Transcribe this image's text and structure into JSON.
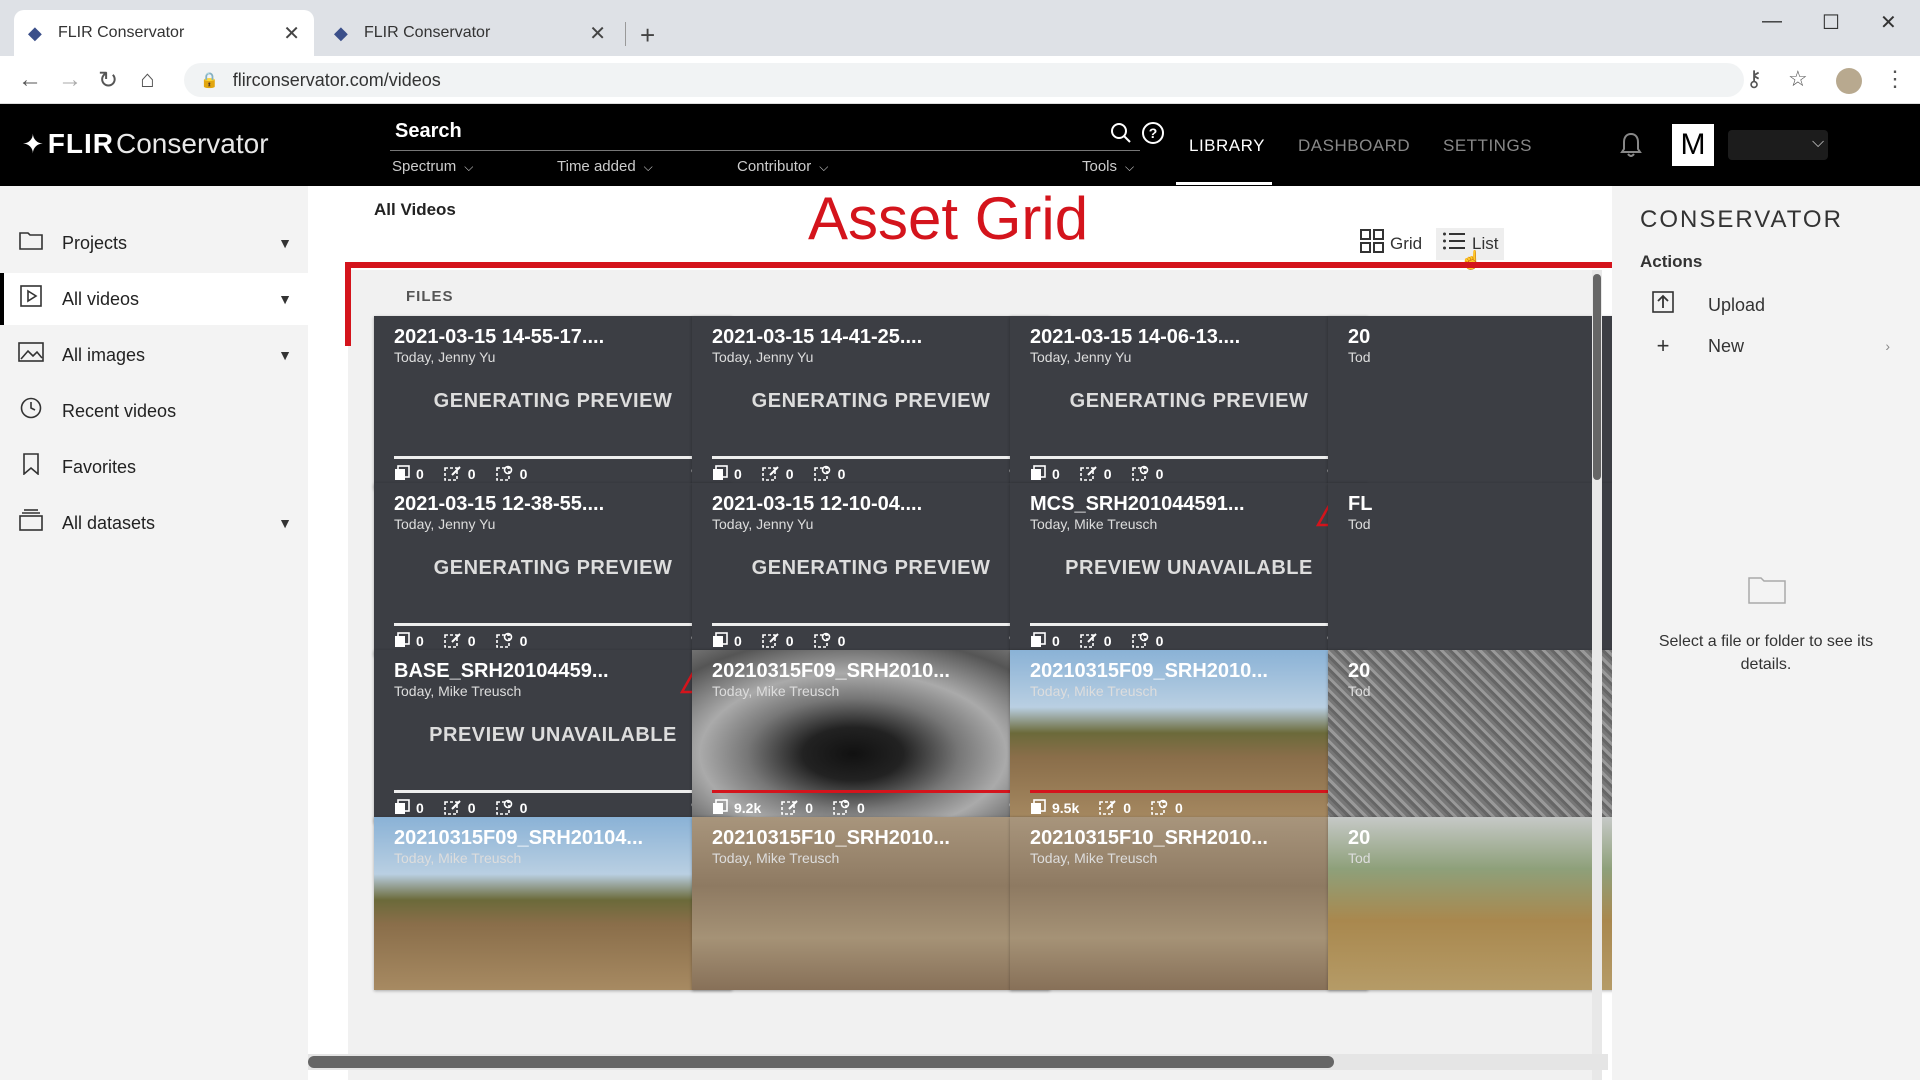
{
  "browser": {
    "tabs": [
      {
        "title": "FLIR Conservator",
        "close": "✕",
        "active": true
      },
      {
        "title": "FLIR Conservator",
        "close": "✕",
        "active": false
      }
    ],
    "new_tab": "+",
    "url": "flirconservator.com/videos"
  },
  "app": {
    "logo_brand": "FLIR",
    "logo_product": "Conservator",
    "search_label": "Search",
    "filters": [
      "Spectrum",
      "Time added",
      "Contributor",
      "Tools"
    ],
    "nav": [
      {
        "label": "LIBRARY",
        "active": true
      },
      {
        "label": "DASHBOARD",
        "active": false
      },
      {
        "label": "SETTINGS",
        "active": false
      }
    ],
    "user_initial": "M"
  },
  "sidebar": {
    "items": [
      {
        "label": "Projects",
        "icon": "folder-icon",
        "has_arrow": true,
        "active": false
      },
      {
        "label": "All videos",
        "icon": "video-icon",
        "has_arrow": true,
        "active": true
      },
      {
        "label": "All images",
        "icon": "image-icon",
        "has_arrow": true,
        "active": false
      },
      {
        "label": "Recent videos",
        "icon": "clock-icon",
        "has_arrow": false,
        "active": false
      },
      {
        "label": "Favorites",
        "icon": "bookmark-icon",
        "has_arrow": false,
        "active": false
      },
      {
        "label": "All datasets",
        "icon": "dataset-icon",
        "has_arrow": true,
        "active": false
      }
    ]
  },
  "main": {
    "heading": "All Videos",
    "annotation": "Asset Grid",
    "view_grid": "Grid",
    "view_list": "List",
    "section": "FILES",
    "cards": [
      {
        "title": "2021-03-15 14-55-17....",
        "sub": "Today, Jenny Yu",
        "status": "GENERATING PREVIEW",
        "frames": "0",
        "annotations": "0",
        "labels": "0",
        "warn": false,
        "thumb": "",
        "bar": "white"
      },
      {
        "title": "2021-03-15 14-41-25....",
        "sub": "Today, Jenny Yu",
        "status": "GENERATING PREVIEW",
        "frames": "0",
        "annotations": "0",
        "labels": "0",
        "warn": false,
        "thumb": "",
        "bar": "white"
      },
      {
        "title": "2021-03-15 14-06-13....",
        "sub": "Today, Jenny Yu",
        "status": "GENERATING PREVIEW",
        "frames": "0",
        "annotations": "0",
        "labels": "0",
        "warn": false,
        "thumb": "",
        "bar": "white"
      },
      {
        "title": "20",
        "sub": "Tod",
        "status": "",
        "frames": "",
        "annotations": "",
        "labels": "",
        "warn": false,
        "thumb": "",
        "bar": "none"
      },
      {
        "title": "2021-03-15 12-38-55....",
        "sub": "Today, Jenny Yu",
        "status": "GENERATING PREVIEW",
        "frames": "0",
        "annotations": "0",
        "labels": "0",
        "warn": false,
        "thumb": "",
        "bar": "white"
      },
      {
        "title": "2021-03-15 12-10-04....",
        "sub": "Today, Jenny Yu",
        "status": "GENERATING PREVIEW",
        "frames": "0",
        "annotations": "0",
        "labels": "0",
        "warn": false,
        "thumb": "",
        "bar": "white"
      },
      {
        "title": "MCS_SRH201044591...",
        "sub": "Today, Mike Treusch",
        "status": "PREVIEW UNAVAILABLE",
        "frames": "0",
        "annotations": "0",
        "labels": "0",
        "warn": true,
        "thumb": "",
        "bar": "white"
      },
      {
        "title": "FL",
        "sub": "Tod",
        "status": "",
        "frames": "",
        "annotations": "",
        "labels": "",
        "warn": false,
        "thumb": "",
        "bar": "none"
      },
      {
        "title": "BASE_SRH20104459...",
        "sub": "Today, Mike Treusch",
        "status": "PREVIEW UNAVAILABLE",
        "frames": "0",
        "annotations": "0",
        "labels": "0",
        "warn": true,
        "thumb": "",
        "bar": "white"
      },
      {
        "title": "20210315F09_SRH2010...",
        "sub": "Today, Mike Treusch",
        "status": "",
        "frames": "9.2k",
        "annotations": "0",
        "labels": "0",
        "warn": false,
        "thumb": "thumb-thermal",
        "bar": "red"
      },
      {
        "title": "20210315F09_SRH2010...",
        "sub": "Today, Mike Treusch",
        "status": "",
        "frames": "9.5k",
        "annotations": "0",
        "labels": "0",
        "warn": false,
        "thumb": "thumb-field",
        "bar": "red"
      },
      {
        "title": "20",
        "sub": "Tod",
        "status": "",
        "frames": "",
        "annotations": "",
        "labels": "",
        "warn": false,
        "thumb": "thumb-pebble",
        "bar": "none"
      },
      {
        "title": "20210315F09_SRH20104...",
        "sub": "Today, Mike Treusch",
        "status": "",
        "frames": "",
        "annotations": "",
        "labels": "",
        "warn": false,
        "thumb": "thumb-field",
        "bar": "none"
      },
      {
        "title": "20210315F10_SRH2010...",
        "sub": "Today, Mike Treusch",
        "status": "",
        "frames": "",
        "annotations": "",
        "labels": "",
        "warn": false,
        "thumb": "thumb-dirt",
        "bar": "none"
      },
      {
        "title": "20210315F10_SRH2010...",
        "sub": "Today, Mike Treusch",
        "status": "",
        "frames": "",
        "annotations": "",
        "labels": "",
        "warn": false,
        "thumb": "thumb-dirt",
        "bar": "none"
      },
      {
        "title": "20",
        "sub": "Tod",
        "status": "",
        "frames": "",
        "annotations": "",
        "labels": "",
        "warn": false,
        "thumb": "thumb-fieldsnow",
        "bar": "none"
      }
    ]
  },
  "right_panel": {
    "title": "CONSERVATOR",
    "actions_label": "Actions",
    "upload_label": "Upload",
    "new_label": "New",
    "hint": "Select a file or folder to see its details."
  },
  "colors": {
    "accent_red": "#d4141c",
    "header_bg": "#000000",
    "card_bg": "#3c3e44"
  }
}
